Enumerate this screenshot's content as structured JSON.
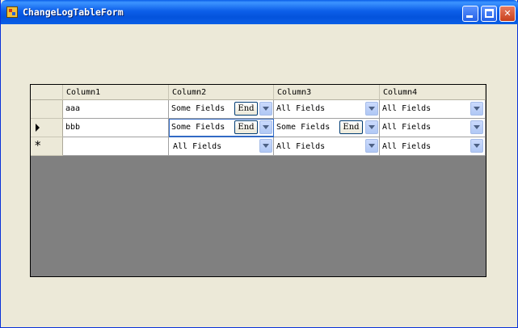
{
  "window": {
    "title": "ChangeLogTableForm",
    "min_label": "",
    "max_label": "",
    "close_label": "✕"
  },
  "grid": {
    "columns": [
      "Column1",
      "Column2",
      "Column3",
      "Column4"
    ],
    "rows": [
      {
        "c1": "aaa",
        "c2": "Some Fields",
        "c2_end": "End",
        "c3": "All Fields",
        "c4": "All Fields"
      },
      {
        "c1": "bbb",
        "c2": "Some Fields",
        "c2_end": "End",
        "c3": "Some Fields",
        "c3_end": "End",
        "c4": "All Fields"
      },
      {
        "c1": "",
        "c2": "All Fields",
        "c3": "All Fields",
        "c4": "All Fields"
      }
    ],
    "new_row_marker": "*"
  }
}
